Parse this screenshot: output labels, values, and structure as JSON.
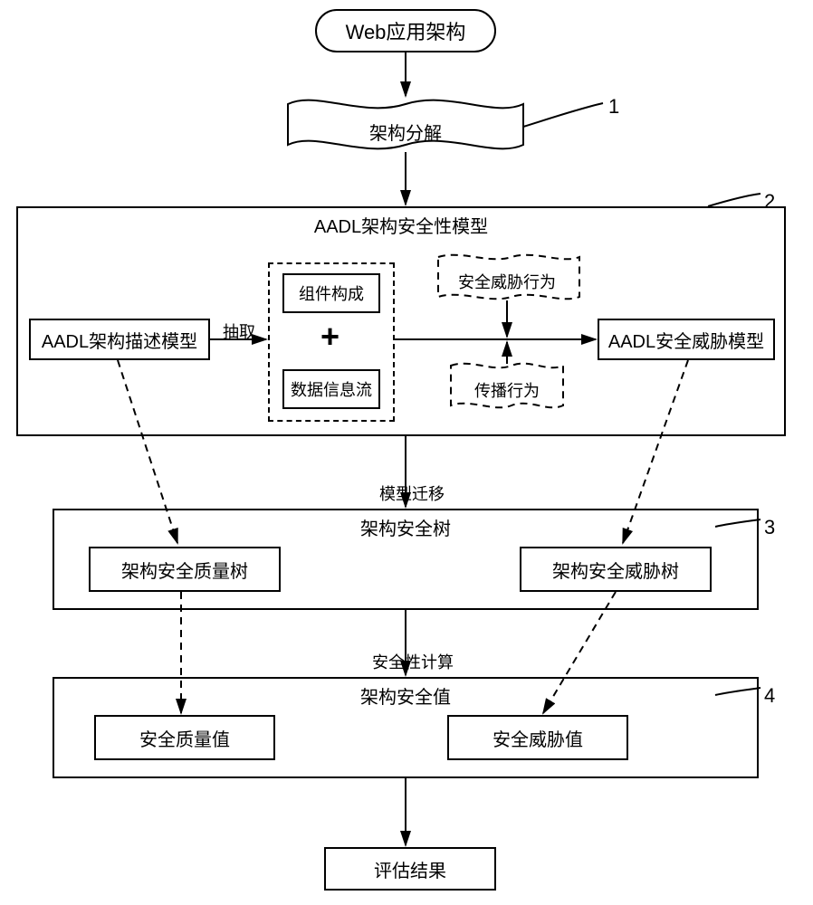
{
  "start": "Web应用架构",
  "decompose": "架构分解",
  "stage2": {
    "title": "AADL架构安全性模型",
    "desc_model": "AADL架构描述模型",
    "extract_label": "抽取",
    "component": "组件构成",
    "dataflow": "数据信息流",
    "threat_behavior": "安全威胁行为",
    "propagation": "传播行为",
    "threat_model": "AADL安全威胁模型"
  },
  "transition23": "模型迁移",
  "stage3": {
    "title": "架构安全树",
    "quality_tree": "架构安全质量树",
    "threat_tree": "架构安全威胁树"
  },
  "transition34": "安全性计算",
  "stage4": {
    "title": "架构安全值",
    "quality_value": "安全质量值",
    "threat_value": "安全威胁值"
  },
  "result": "评估结果",
  "labels": {
    "n1": "1",
    "n2": "2",
    "n3": "3",
    "n4": "4"
  }
}
